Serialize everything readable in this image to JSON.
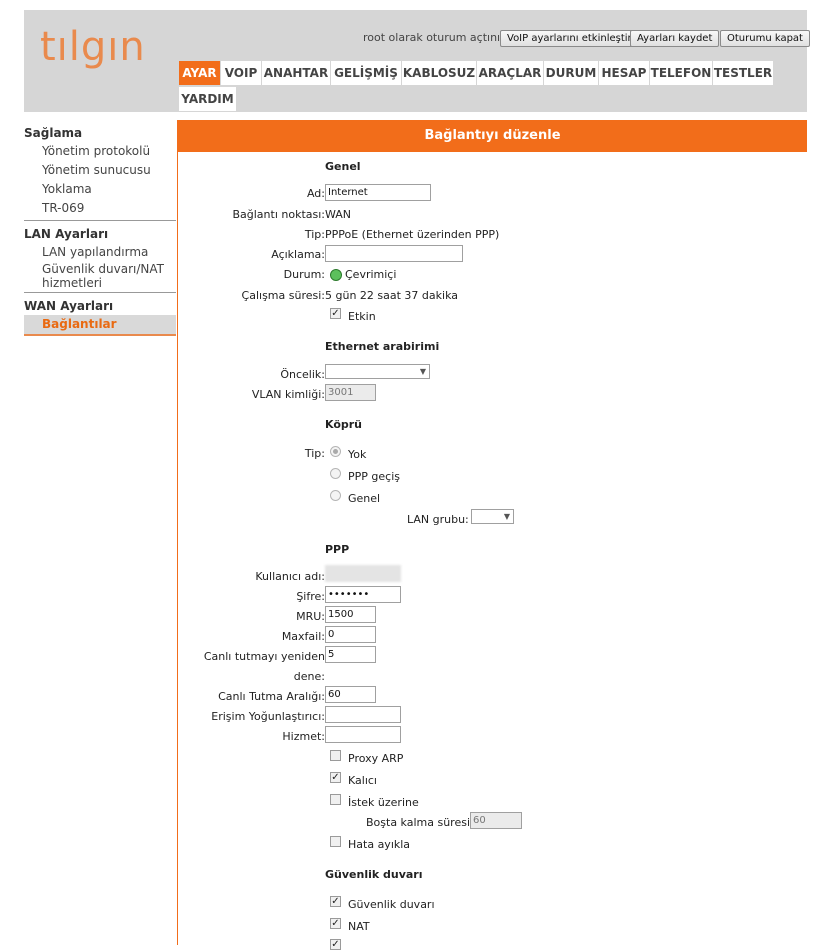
{
  "header": {
    "logo": "tılgın",
    "login_text": "root olarak oturum açtınız.",
    "buttons": [
      "VoIP ayarlarını etkinleştir",
      "Ayarları kaydet",
      "Oturumu kapat"
    ]
  },
  "tabs": [
    "AYAR",
    "VOIP",
    "ANAHTAR",
    "GELİŞMİŞ",
    "KABLOSUZ",
    "ARAÇLAR",
    "DURUM",
    "HESAP",
    "TELEFON",
    "TESTLER",
    "YARDIM"
  ],
  "active_tab": "AYAR",
  "sidebar": {
    "groups": [
      {
        "title": "Sağlama",
        "items": [
          "Yönetim protokolü",
          "Yönetim sunucusu",
          "Yoklama",
          "TR-069"
        ]
      },
      {
        "title": "LAN Ayarları",
        "items": [
          "LAN yapılandırma",
          "Güvenlik duvarı/NAT hizmetleri"
        ]
      },
      {
        "title": "WAN Ayarları",
        "items": [
          "Bağlantılar"
        ]
      }
    ],
    "selected": "Bağlantılar"
  },
  "banner": "Bağlantıyı düzenle",
  "general": {
    "section": "Genel",
    "name_label": "Ad:",
    "name_value": "Internet",
    "conn_point_label": "Bağlantı noktası:",
    "conn_point_value": "WAN",
    "type_label": "Tip:",
    "type_value": "PPPoE (Ethernet üzerinden PPP)",
    "desc_label": "Açıklama:",
    "desc_value": "",
    "status_label": "Durum:",
    "status_value": "Çevrimiçi",
    "uptime_label": "Çalışma süresi:",
    "uptime_value": "5 gün 22 saat 37 dakika",
    "enabled_label": "Etkin"
  },
  "ethernet": {
    "section": "Ethernet arabirimi",
    "priority_label": "Öncelik:",
    "vlan_label": "VLAN kimliği:",
    "vlan_value": "3001"
  },
  "bridge": {
    "section": "Köprü",
    "type_label": "Tip:",
    "options": [
      "Yok",
      "PPP geçiş",
      "Genel"
    ],
    "lan_group_label": "LAN grubu:"
  },
  "ppp": {
    "section": "PPP",
    "user_label": "Kullanıcı adı:",
    "pass_label": "Şifre:",
    "pass_value": "•••••••",
    "mru_label": "MRU:",
    "mru_value": "1500",
    "maxfail_label": "Maxfail:",
    "maxfail_value": "0",
    "keepalive_retry_label_1": "Canlı tutmayı yeniden",
    "keepalive_retry_label_2": "dene:",
    "keepalive_retry_value": "5",
    "keepalive_interval_label": "Canlı Tutma Aralığı:",
    "keepalive_interval_value": "60",
    "concentrator_label": "Erişim Yoğunlaştırıcı:",
    "service_label": "Hizmet:",
    "proxy_arp_label": "Proxy ARP",
    "persistent_label": "Kalıcı",
    "on_demand_label": "İstek üzerine",
    "idle_label": "Boşta kalma süresi:",
    "idle_value": "60",
    "debug_label": "Hata ayıkla"
  },
  "firewall": {
    "section": "Güvenlik duvarı",
    "firewall_label": "Güvenlik duvarı",
    "nat_label": "NAT"
  }
}
